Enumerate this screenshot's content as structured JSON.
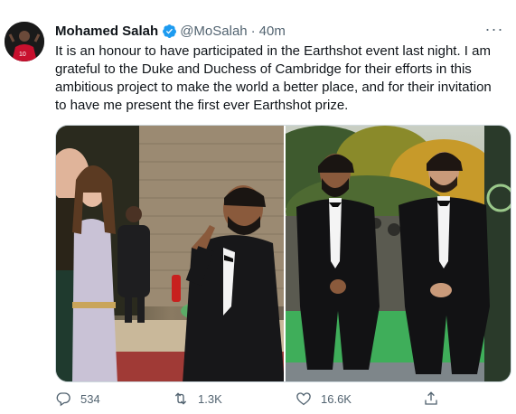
{
  "tweet": {
    "author_name": "Mohamed Salah",
    "handle": "@MoSalah",
    "separator": "·",
    "time": "40m",
    "more_label": "···",
    "text": "It is an honour to have participated in the Earthshot event last night. I am grateful to the Duke and Duchess of Cambridge for their efforts in this ambitious project to make the world a better place, and for their invitation to have me present the first ever Earthshot prize.",
    "text_lines": [
      "It is an honour to have participated in the Earthshot event last night. I am",
      "grateful to the Duke and Duchess of Cambridge for their efforts in this",
      "ambitious project to make the world a better place, and for their invitation",
      "to have me present the first ever Earthshot prize."
    ]
  },
  "actions": {
    "replies": "534",
    "retweets": "1.3K",
    "likes": "16.6K",
    "share_label": ""
  },
  "colors": {
    "verified": "#1d9bf0",
    "muted": "#536471",
    "text": "#0f1419"
  }
}
